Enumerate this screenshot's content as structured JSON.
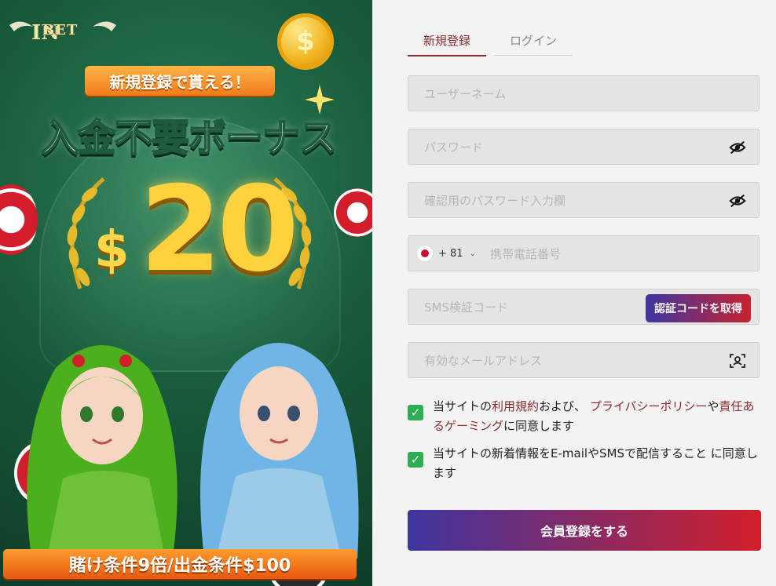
{
  "promo": {
    "logo_text": "BET",
    "ribbon": "新規登録で貰える！",
    "headline": "入金不要ボーナス",
    "currency": "$",
    "amount": "20",
    "footer": "賭け条件9倍/出金条件$100",
    "coin_glyph": "$"
  },
  "tabs": {
    "register": "新規登録",
    "login": "ログイン"
  },
  "fields": {
    "username_placeholder": "ユーザーネーム",
    "password_placeholder": "パスワード",
    "confirm_placeholder": "確認用のパスワード入力欄",
    "country_code": "+ 81",
    "phone_placeholder": "携帯電話番号",
    "sms_placeholder": "SMS検証コード",
    "sms_button": "認証コードを取得",
    "email_placeholder": "有効なメールアドレス"
  },
  "agreements": {
    "terms_prefix": "当サイトの",
    "terms_link": "利用規約",
    "terms_mid": "および、",
    "privacy_link": "プライバシーポリシー",
    "terms_mid2": "や",
    "responsible_link": "責任あるゲーミング",
    "terms_suffix": "に同意します",
    "newsletter": "当サイトの新着情報をE-mailやSMSで配信すること に同意します"
  },
  "submit_label": "会員登録をする",
  "colors": {
    "accent": "#8b2a2f",
    "check": "#2eae53",
    "gradient_start": "#3e35a0",
    "gradient_end": "#d21f2a"
  }
}
